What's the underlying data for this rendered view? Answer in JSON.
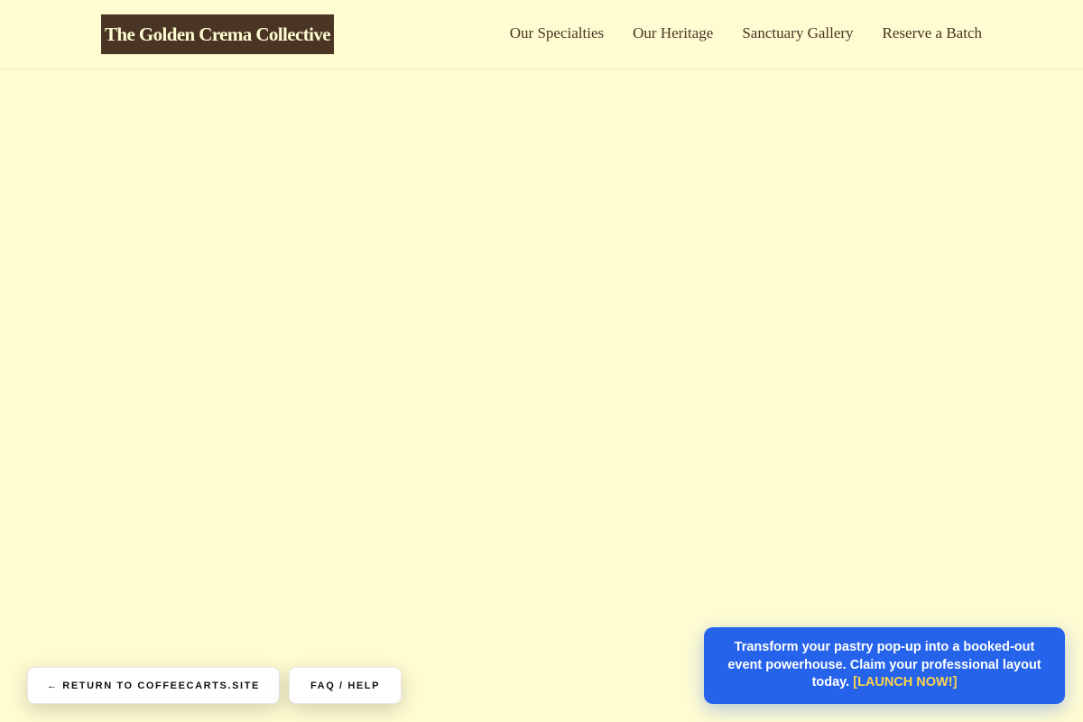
{
  "header": {
    "logo_text": "The Golden Crema Collective",
    "nav": [
      {
        "label": "Our Specialties"
      },
      {
        "label": "Our Heritage"
      },
      {
        "label": "Sanctuary Gallery"
      },
      {
        "label": "Reserve a Batch"
      }
    ]
  },
  "floating": {
    "return_label": "← RETURN TO COFFEECARTS.SITE",
    "faq_label": "FAQ / HELP"
  },
  "promo": {
    "message": "Transform your pastry pop-up into a booked-out event powerhouse. Claim your professional layout today.",
    "cta": "[LAUNCH NOW!]"
  },
  "colors": {
    "page_background": "#fffcd2",
    "logo_background": "#4a3524",
    "nav_text": "#4a3524",
    "promo_background": "#2563eb",
    "promo_cta": "#fcd34d"
  }
}
